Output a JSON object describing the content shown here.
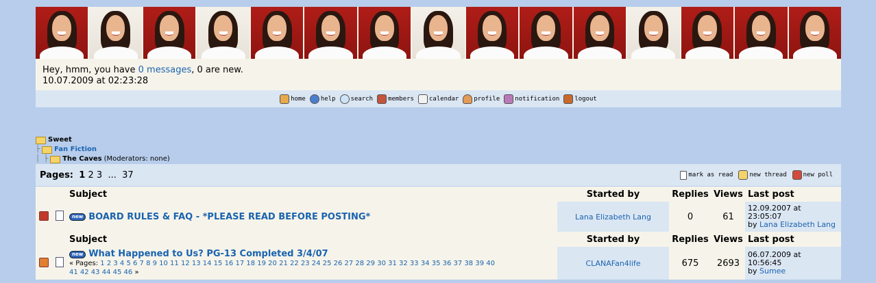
{
  "header": {
    "greeting_prefix": "Hey, hmm, you have ",
    "messages_link": "0 messages",
    "greeting_suffix": ", 0 are new.",
    "datetime": "10.07.2009 at 02:23:28"
  },
  "nav": [
    {
      "label": "home",
      "icon": "home-icon"
    },
    {
      "label": "help",
      "icon": "help-icon"
    },
    {
      "label": "search",
      "icon": "search-icon"
    },
    {
      "label": "members",
      "icon": "members-icon"
    },
    {
      "label": "calendar",
      "icon": "calendar-icon"
    },
    {
      "label": "profile",
      "icon": "profile-icon"
    },
    {
      "label": "notification",
      "icon": "notification-icon"
    },
    {
      "label": "logout",
      "icon": "logout-icon"
    }
  ],
  "breadcrumb": {
    "root": "Sweet",
    "forum": "Fan Fiction",
    "board": "The Caves",
    "moderators": "(Moderators: none)"
  },
  "pagination": {
    "label": "Pages:",
    "current": "1",
    "p2": "2",
    "p3": "3",
    "ellipsis": "...",
    "last": "37"
  },
  "actions": {
    "mark_read": "mark as read",
    "new_thread": "new thread",
    "new_poll": "new poll"
  },
  "columns": {
    "subject": "Subject",
    "started_by": "Started by",
    "replies": "Replies",
    "views": "Views",
    "last_post": "Last post"
  },
  "threads": [
    {
      "new_badge": "new",
      "title": "BOARD RULES & FAQ - *PLEASE READ BEFORE POSTING*",
      "started_by": "Lana Elizabeth Lang",
      "replies": "0",
      "views": "61",
      "last_date": "12.09.2007 at",
      "last_time": "23:05:07",
      "by_label": "by",
      "last_user": "Lana Elizabeth Lang"
    },
    {
      "new_badge": "new",
      "title": "What Happened to Us? PG-13 Completed 3/4/07",
      "pages_prefix": "« Pages:",
      "pages_line1": "1 2 3 4 5 6 7 8 9 10 11 12 13 14 15 16 17 18 19 20 21 22 23 24 25 26 27 28 29 30 31 32 33 34 35 36 37 38 39 40",
      "pages_line2": "41 42 43 44 45 46",
      "pages_suffix": "»",
      "started_by": "CLANAFan4life",
      "replies": "675",
      "views": "2693",
      "last_date": "06.07.2009 at",
      "last_time": "10:56:45",
      "by_label": "by",
      "last_user": "Sumee"
    }
  ],
  "colors": {
    "background": "#b7cdeb",
    "panel": "#f6f4ea",
    "band": "#dbe6f3",
    "link": "#1a63b0",
    "banner_red": "#a81a16"
  }
}
